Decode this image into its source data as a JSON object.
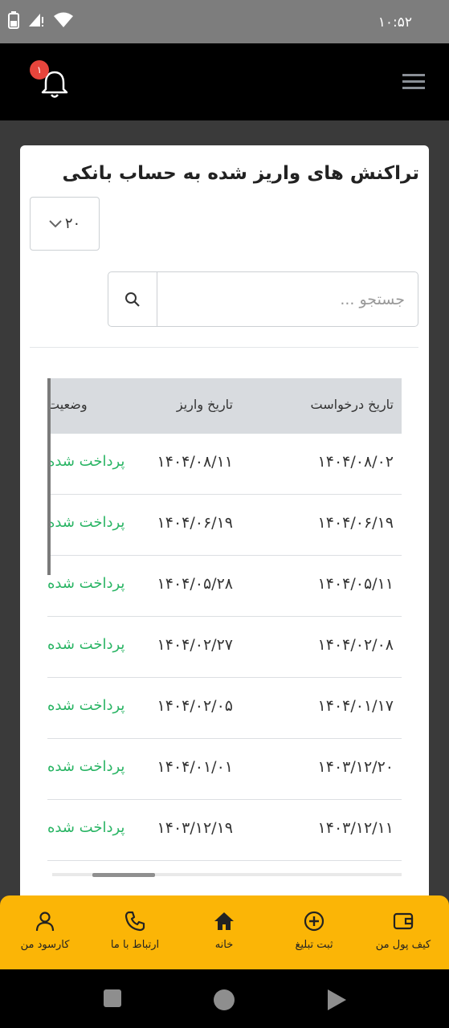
{
  "status_bar": {
    "time": "۱۰:۵۲",
    "icons": [
      "battery-icon",
      "no-sim-icon",
      "wifi-icon"
    ]
  },
  "header": {
    "notification_count": "۱",
    "icons": [
      "bell-icon",
      "hamburger-menu-icon"
    ]
  },
  "card": {
    "title": "تراکنش های واریز شده به حساب بانکی",
    "page_size": "۲۰",
    "search": {
      "placeholder": "جستجو ..."
    }
  },
  "table": {
    "columns": [
      "تاریخ درخواست",
      "تاریخ واریز",
      "وضعیت"
    ],
    "rows": [
      {
        "request_date": "۱۴۰۴/۰۸/۰۲",
        "deposit_date": "۱۴۰۴/۰۸/۱۱",
        "status": "پرداخت شده"
      },
      {
        "request_date": "۱۴۰۴/۰۶/۱۹",
        "deposit_date": "۱۴۰۴/۰۶/۱۹",
        "status": "پرداخت شده"
      },
      {
        "request_date": "۱۴۰۴/۰۵/۱۱",
        "deposit_date": "۱۴۰۴/۰۵/۲۸",
        "status": "پرداخت شده"
      },
      {
        "request_date": "۱۴۰۴/۰۲/۰۸",
        "deposit_date": "۱۴۰۴/۰۲/۲۷",
        "status": "پرداخت شده"
      },
      {
        "request_date": "۱۴۰۴/۰۱/۱۷",
        "deposit_date": "۱۴۰۴/۰۲/۰۵",
        "status": "پرداخت شده"
      },
      {
        "request_date": "۱۴۰۳/۱۲/۲۰",
        "deposit_date": "۱۴۰۴/۰۱/۰۱",
        "status": "پرداخت شده"
      },
      {
        "request_date": "۱۴۰۳/۱۲/۱۱",
        "deposit_date": "۱۴۰۳/۱۲/۱۹",
        "status": "پرداخت شده"
      }
    ]
  },
  "bottom_nav": {
    "items": [
      {
        "label": "کیف پول من",
        "icon": "wallet-icon"
      },
      {
        "label": "ثبت تبلیغ",
        "icon": "plus-circle-icon"
      },
      {
        "label": "خانه",
        "icon": "home-icon"
      },
      {
        "label": "ارتباط با ما",
        "icon": "phone-icon"
      },
      {
        "label": "کارسود من",
        "icon": "user-icon"
      }
    ]
  },
  "system_nav": {
    "icons": [
      "recents-square-icon",
      "home-circle-icon",
      "back-triangle-icon"
    ]
  },
  "colors": {
    "accent": "#fbb506",
    "status_paid": "#28b463",
    "badge": "#e8453c",
    "header_row": "#d8dbdf"
  }
}
